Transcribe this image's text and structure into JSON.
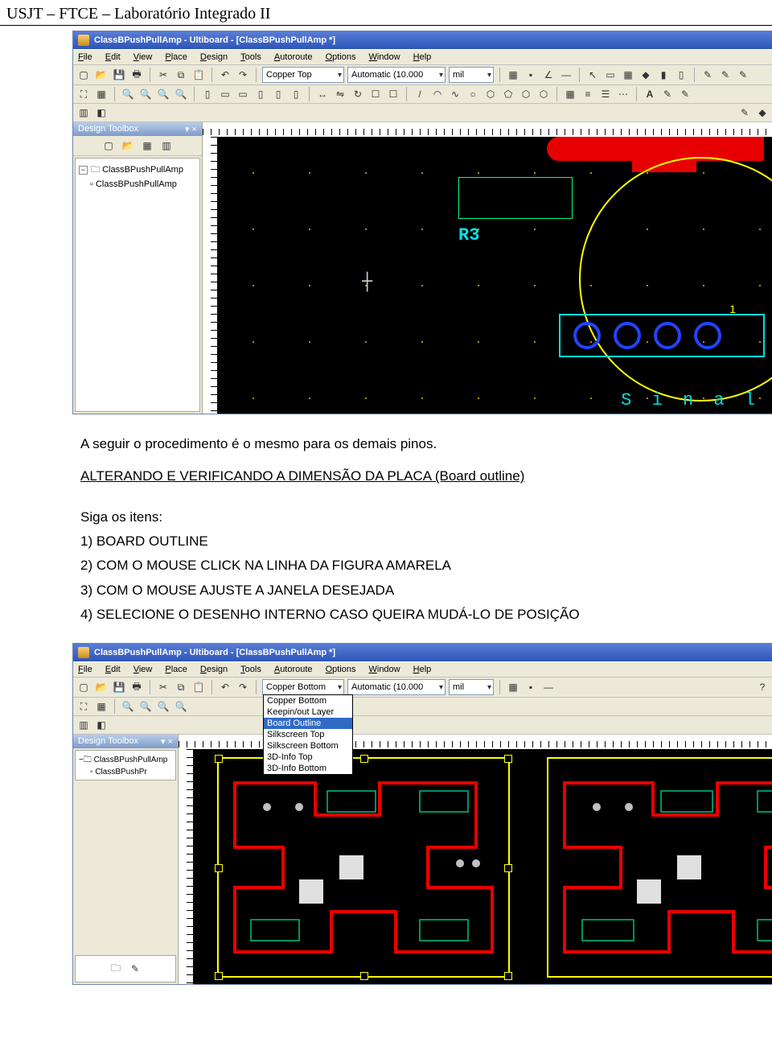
{
  "doc": {
    "header": "USJT – FTCE – Laboratório Integrado II",
    "body_p1": "A seguir o procedimento é o mesmo para os demais pinos.",
    "body_p2": "ALTERANDO E VERIFICANDO A DIMENSÃO DA PLACA (Board outline)",
    "siga": "Siga os itens:",
    "items": [
      "1)   BOARD OUTLINE",
      "2)   COM O MOUSE CLICK NA LINHA DA FIGURA AMARELA",
      "3)   COM O MOUSE AJUSTE A JANELA DESEJADA",
      "4)   SELECIONE O DESENHO INTERNO CASO QUEIRA MUDÁ-LO DE POSIÇÃO"
    ]
  },
  "app": {
    "title": "ClassBPushPullAmp - Ultiboard - [ClassBPushPullAmp *]",
    "menus": [
      "File",
      "Edit",
      "View",
      "Place",
      "Design",
      "Tools",
      "Autoroute",
      "Options",
      "Window",
      "Help"
    ],
    "layer_combo": "Copper Top",
    "units_combo": "Automatic (10.000",
    "unit_small": "mil",
    "side_panel_title": "Design Toolbox",
    "tree_root": "ClassBPushPullAmp",
    "tree_child": "ClassBPushPullAmp",
    "refdes": "R3",
    "chip_index": "1",
    "bottom_text": "S i n a l"
  },
  "app2": {
    "title": "ClassBPushPullAmp - Ultiboard - [ClassBPushPullAmp *]",
    "menus": [
      "File",
      "Edit",
      "View",
      "Place",
      "Design",
      "Tools",
      "Autoroute",
      "Options",
      "Window",
      "Help"
    ],
    "layer_combo_value": "Copper Bottom",
    "layer_options": [
      "Copper Bottom",
      "Keepin/out Layer",
      "Board Outline",
      "Silkscreen Top",
      "Silkscreen Bottom",
      "3D-Info Top",
      "3D-Info Bottom"
    ],
    "layer_selected_index": 2,
    "units_combo": "Automatic (10.000",
    "unit_small": "mil",
    "side_panel_title": "Design Toolbox",
    "tree_root": "ClassBPushPullAmp",
    "tree_child": "ClassBPushPr"
  }
}
